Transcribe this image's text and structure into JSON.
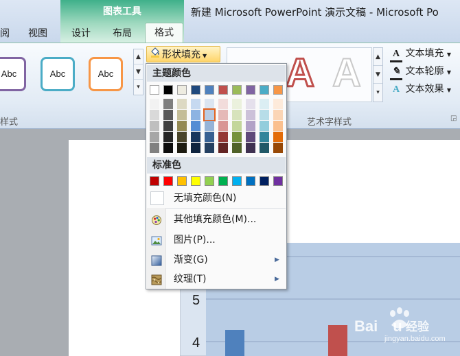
{
  "window": {
    "contextual_tab_group": "图表工具",
    "title": "新建 Microsoft PowerPoint 演示文稿 - Microsoft Po"
  },
  "tabs": {
    "partial": "阅",
    "view": "视图",
    "design": "设计",
    "layout": "布局",
    "format": "格式"
  },
  "shape_styles": {
    "samples": [
      "Abc",
      "Abc",
      "Abc"
    ],
    "group_label": "样式",
    "sample_colors": [
      "#8064a2",
      "#4bacc6",
      "#f79646"
    ]
  },
  "shape_fill": {
    "label": "形状填充",
    "icon": "paint-bucket-icon"
  },
  "wordart": {
    "group_label": "艺术字样式",
    "text_fill": "文本填充",
    "text_outline": "文本轮廓",
    "text_effect": "文本效果"
  },
  "dropdown": {
    "theme_colors_heading": "主题颜色",
    "standard_colors_heading": "标准色",
    "theme_top_row": [
      "#ffffff",
      "#000000",
      "#eeece1",
      "#1f497d",
      "#4f81bd",
      "#c0504d",
      "#9bbb59",
      "#8064a2",
      "#4bacc6",
      "#f79646"
    ],
    "theme_shades": [
      [
        "#f2f2f2",
        "#d9d9d9",
        "#bfbfbf",
        "#a6a6a6",
        "#808080"
      ],
      [
        "#7f7f7f",
        "#595959",
        "#404040",
        "#262626",
        "#0d0d0d"
      ],
      [
        "#ddd9c3",
        "#c4bd97",
        "#948a54",
        "#4a452a",
        "#1d1b10"
      ],
      [
        "#c6d9f0",
        "#8db3e2",
        "#548dd4",
        "#17365d",
        "#0f243e"
      ],
      [
        "#dbe5f1",
        "#b8cce4",
        "#95b3d7",
        "#366092",
        "#244061"
      ],
      [
        "#f2dcdb",
        "#e5b9b7",
        "#d99694",
        "#953734",
        "#632423"
      ],
      [
        "#ebf1dd",
        "#d7e3bc",
        "#c3d69b",
        "#76923c",
        "#4f6128"
      ],
      [
        "#e5e0ec",
        "#ccc1d9",
        "#b2a2c7",
        "#5f497a",
        "#3f3151"
      ],
      [
        "#dbeef3",
        "#b7dde8",
        "#92cddc",
        "#31859b",
        "#205867"
      ],
      [
        "#fdeada",
        "#fbd5b5",
        "#fac08f",
        "#e36c09",
        "#974806"
      ]
    ],
    "selected_shade": {
      "column": 4,
      "row": 1
    },
    "standard_colors": [
      "#c00000",
      "#ff0000",
      "#ffc000",
      "#ffff00",
      "#92d050",
      "#00b050",
      "#00b0f0",
      "#0070c0",
      "#002060",
      "#7030a0"
    ],
    "no_fill": "无填充颜色(N)",
    "more_colors": "其他填充颜色(M)...",
    "picture": "图片(P)...",
    "gradient": "渐变(G)",
    "texture": "纹理(T)"
  },
  "chart": {
    "y_ticks": [
      "5",
      "4"
    ],
    "bar_colors": [
      "#4f81bd",
      "#c0504d"
    ],
    "plot_background": "#b9cde5"
  },
  "watermark": {
    "brand": "Bai",
    "jingyan": "经验",
    "url": "jingyan.baidu.com"
  }
}
